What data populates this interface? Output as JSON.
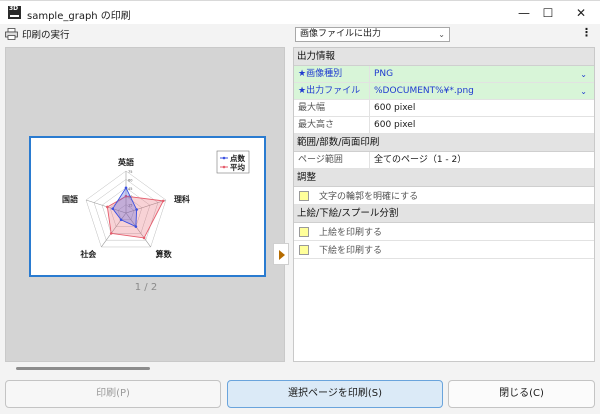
{
  "window": {
    "title": "sample_graph の印刷",
    "app_icon_text": "3D",
    "minimize": "—",
    "maximize": "☐",
    "close": "✕"
  },
  "toolbar": {
    "print_run_label": "印刷の実行",
    "output_select": "画像ファイルに出力",
    "more": "⋮"
  },
  "preview": {
    "page_indicator": "1 / 2"
  },
  "chart_data": {
    "type": "radar",
    "categories": [
      "英語",
      "理科",
      "算数",
      "社会",
      "国語"
    ],
    "series": [
      {
        "name": "点数",
        "values": [
          45,
          20,
          30,
          15,
          25
        ],
        "color": "#3a4fe0"
      },
      {
        "name": "平均",
        "values": [
          30,
          70,
          55,
          45,
          35
        ],
        "color": "#e55c6c"
      }
    ],
    "max": 75,
    "tick_labels": [
      "15",
      "30",
      "45",
      "60",
      "75"
    ]
  },
  "properties": {
    "sections": {
      "output_info": "出力情報",
      "range": "範囲/部数/両面印刷",
      "adjust": "調整",
      "split": "上絵/下絵/スプール分割"
    },
    "image_type": {
      "key": "★画像種別",
      "value": "PNG"
    },
    "output_file": {
      "key": "★出力ファイル",
      "value": "%DOCUMENT%¥*.png"
    },
    "max_width": {
      "key": "最大幅",
      "value": "600 pixel"
    },
    "max_height": {
      "key": "最大高さ",
      "value": "600 pixel"
    },
    "page_range": {
      "key": "ページ範囲",
      "value": "全てのページ（1 - 2）"
    },
    "sharpen": "文字の輪郭を明確にする",
    "print_over": "上絵を印刷する",
    "print_under": "下絵を印刷する"
  },
  "buttons": {
    "print": "印刷(P)",
    "print_selected": "選択ページを印刷(S)",
    "close": "閉じる(C)"
  }
}
